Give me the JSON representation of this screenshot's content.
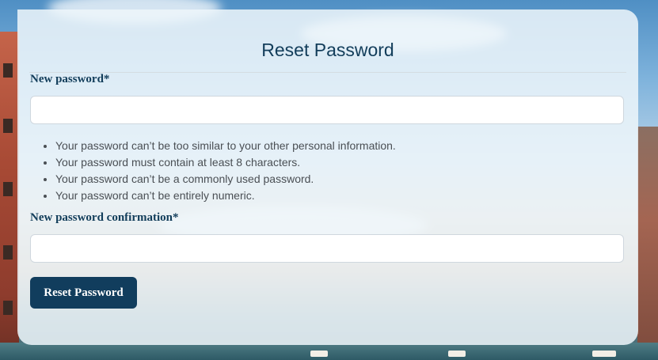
{
  "form": {
    "title": "Reset Password",
    "new_password_label": "New password*",
    "new_password_value": "",
    "hints": [
      "Your password can’t be too similar to your other personal information.",
      "Your password must contain at least 8 characters.",
      "Your password can’t be a commonly used password.",
      "Your password can’t be entirely numeric."
    ],
    "confirm_password_label": "New password confirmation*",
    "confirm_password_value": "",
    "submit_label": "Reset Password"
  },
  "colors": {
    "accent": "#123d5a",
    "button_bg": "#113d5d",
    "card_bg": "#eef6fa"
  }
}
